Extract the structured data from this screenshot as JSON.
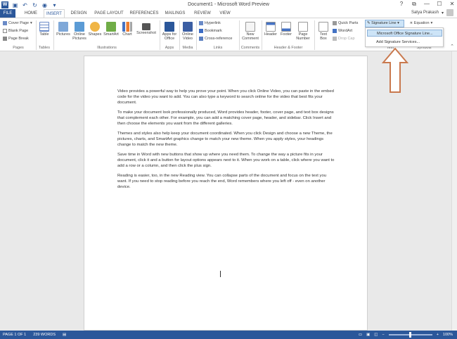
{
  "window": {
    "title": "Document1 - Microsoft Word Preview",
    "controls": {
      "help": "?",
      "ribbon_display": "⧉",
      "minimize": "—",
      "maximize": "☐",
      "close": "✕"
    }
  },
  "tabs": [
    {
      "label": "FILE"
    },
    {
      "label": "HOME"
    },
    {
      "label": "INSERT"
    },
    {
      "label": "DESIGN"
    },
    {
      "label": "PAGE LAYOUT"
    },
    {
      "label": "REFERENCES"
    },
    {
      "label": "MAILINGS"
    },
    {
      "label": "REVIEW"
    },
    {
      "label": "VIEW"
    }
  ],
  "user": {
    "name": "Satya Prakash"
  },
  "ribbon": {
    "pages": {
      "cover_page": "Cover Page",
      "blank_page": "Blank Page",
      "page_break": "Page Break",
      "label": "Pages"
    },
    "tables": {
      "table": "Table",
      "label": "Tables"
    },
    "illustrations": {
      "pictures": "Pictures",
      "online_pictures": "Online Pictures",
      "shapes": "Shapes",
      "smartart": "SmartArt",
      "chart": "Chart",
      "screenshot": "Screenshot",
      "label": "Illustrations"
    },
    "apps": {
      "apps_for_office": "Apps for Office",
      "label": "Apps"
    },
    "media": {
      "online_video": "Online Video",
      "label": "Media"
    },
    "links": {
      "hyperlink": "Hyperlink",
      "bookmark": "Bookmark",
      "cross_reference": "Cross-reference",
      "label": "Links"
    },
    "comments": {
      "new_comment": "New Comment",
      "label": "Comments"
    },
    "header_footer": {
      "header": "Header",
      "footer": "Footer",
      "page_number": "Page Number",
      "label": "Header & Footer"
    },
    "text": {
      "text_box": "Text Box",
      "quick_parts": "Quick Parts",
      "wordart": "WordArt",
      "drop_cap": "Drop Cap",
      "label": "Text"
    },
    "symbols": {
      "equation": "Equation",
      "label": "Symbols"
    },
    "signature_line": "Signature Line"
  },
  "signature_dropdown": {
    "items": [
      "Microsoft Office Signature Line...",
      "Add Signature Services..."
    ]
  },
  "document": {
    "paragraphs": [
      "Video provides a powerful way to help you prove your point. When you click Online Video, you can paste in the embed code for the video you want to add. You can also type a keyword to search online for the video that best fits your document.",
      "To make your document look professionally produced, Word provides header, footer, cover page, and text box designs that complement each other. For example, you can add a matching cover page, header, and sidebar. Click Insert and then choose the elements you want from the different galleries.",
      "Themes and styles also help keep your document coordinated. When you click Design and choose a new Theme, the pictures, charts, and SmartArt graphics change to match your new theme. When you apply styles, your headings change to match the new theme.",
      "Save time in Word with new buttons that show up where you need them. To change the way a picture fits in your document, click it and a button for layout options appears next to it. When you work on a table, click where you want to add a row or a column, and then click the plus sign.",
      "Reading is easier, too, in the new Reading view. You can collapse parts of the document and focus on the text you want. If you need to stop reading before you reach the end, Word remembers where you left off - even on another device."
    ]
  },
  "status": {
    "page": "PAGE 1 OF 1",
    "words": "239 WORDS",
    "zoom_minus": "−",
    "zoom_plus": "+",
    "zoom": "100%"
  },
  "colors": {
    "accent": "#2b579a",
    "highlight": "#cde4f7",
    "arrow": "#c9794e"
  }
}
